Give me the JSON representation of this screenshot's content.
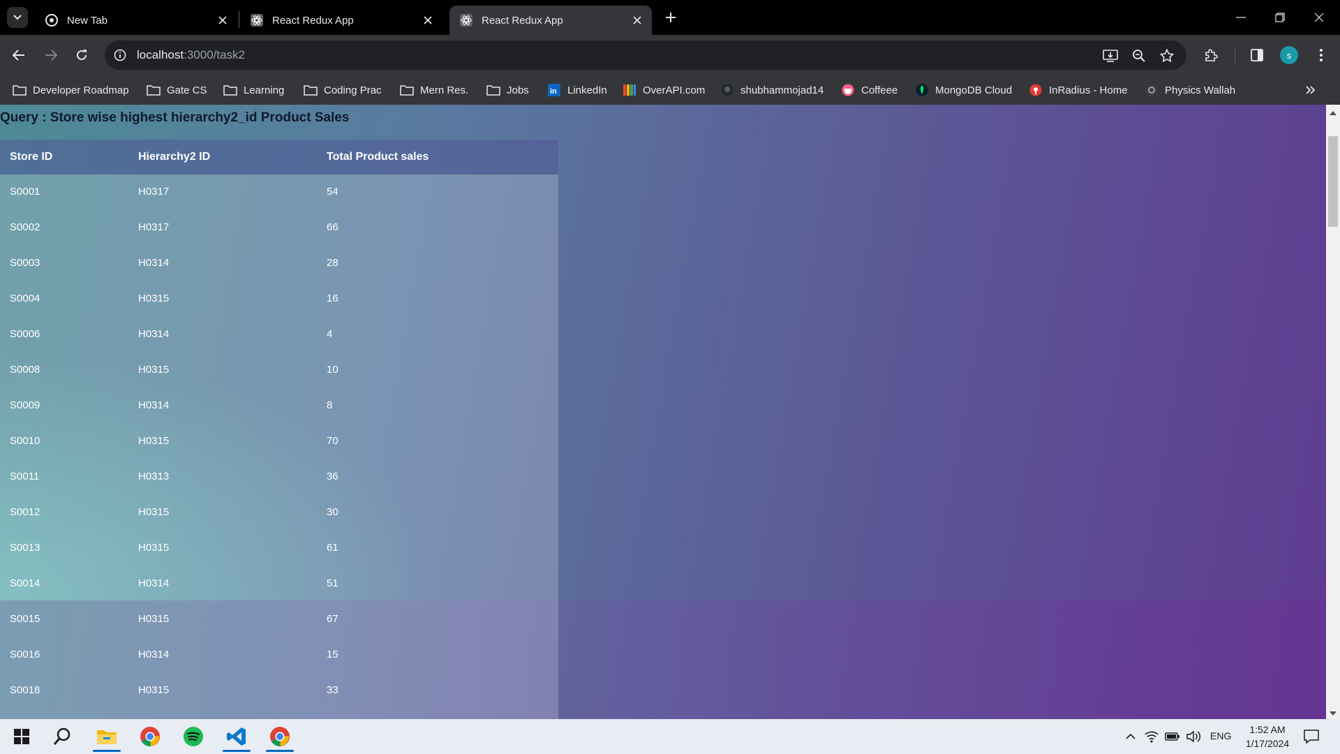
{
  "browser": {
    "tabs": [
      {
        "title": "New Tab",
        "active": false
      },
      {
        "title": "React Redux App",
        "active": false
      },
      {
        "title": "React Redux App",
        "active": true
      }
    ],
    "url_host": "localhost",
    "url_path": ":3000/task2",
    "profile_initial": "s"
  },
  "bookmarks": [
    {
      "label": "Developer Roadmap",
      "icon": "folder-icon"
    },
    {
      "label": "Gate CS",
      "icon": "folder-icon"
    },
    {
      "label": "Learning",
      "icon": "folder-icon"
    },
    {
      "label": "Coding Prac",
      "icon": "folder-icon"
    },
    {
      "label": "Mern Res.",
      "icon": "folder-icon"
    },
    {
      "label": "Jobs",
      "icon": "folder-icon"
    },
    {
      "label": "LinkedIn",
      "icon": "linkedin-icon"
    },
    {
      "label": "OverAPI.com",
      "icon": "overapi-icon"
    },
    {
      "label": "shubhammojad14",
      "icon": "github-icon"
    },
    {
      "label": "Coffeee",
      "icon": "coffee-icon"
    },
    {
      "label": "MongoDB Cloud",
      "icon": "mongodb-icon"
    },
    {
      "label": "InRadius - Home",
      "icon": "inradius-icon"
    },
    {
      "label": "Physics Wallah",
      "icon": "physics-wallah-icon"
    }
  ],
  "page": {
    "query_title": "Query : Store wise highest hierarchy2_id Product Sales",
    "table": {
      "headers": [
        "Store ID",
        "Hierarchy2 ID",
        "Total Product sales"
      ],
      "rows": [
        [
          "S0001",
          "H0317",
          "54"
        ],
        [
          "S0002",
          "H0317",
          "66"
        ],
        [
          "S0003",
          "H0314",
          "28"
        ],
        [
          "S0004",
          "H0315",
          "16"
        ],
        [
          "S0006",
          "H0314",
          "4"
        ],
        [
          "S0008",
          "H0315",
          "10"
        ],
        [
          "S0009",
          "H0314",
          "8"
        ],
        [
          "S0010",
          "H0315",
          "70"
        ],
        [
          "S0011",
          "H0313",
          "36"
        ],
        [
          "S0012",
          "H0315",
          "30"
        ],
        [
          "S0013",
          "H0315",
          "61"
        ],
        [
          "S0014",
          "H0314",
          "51"
        ],
        [
          "S0015",
          "H0315",
          "67"
        ],
        [
          "S0016",
          "H0314",
          "15"
        ],
        [
          "S0018",
          "H0315",
          "33"
        ]
      ]
    }
  },
  "taskbar": {
    "apps": [
      "start-icon",
      "search-icon",
      "file-explorer-icon",
      "chrome-icon",
      "spotify-icon",
      "vscode-icon",
      "chrome-active-icon"
    ],
    "language": "ENG",
    "time": "1:52 AM",
    "date": "1/17/2024"
  },
  "colors": {
    "page_gradient_left": "#4e8a96",
    "page_gradient_right": "#5f3a90",
    "title_text": "#0e1a2c"
  }
}
